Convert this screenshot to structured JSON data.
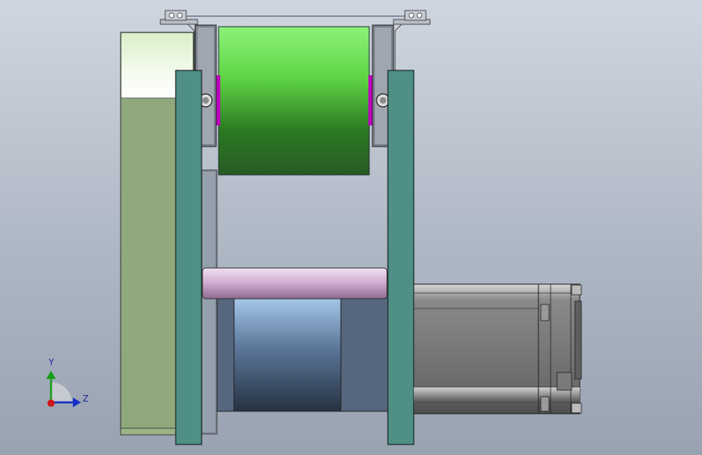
{
  "viewport": {
    "background_top": "#cfd6e0",
    "background_bottom": "#99a2b1"
  },
  "model": {
    "parts": [
      "top-roller",
      "bottom-roller",
      "shaft",
      "left-side-plate",
      "right-side-plate",
      "back-plate",
      "roller-bearing-blocks",
      "top-bracket",
      "motor"
    ],
    "colors": {
      "top_roller": "#3fbf2f",
      "bottom_roller": "#6f9cc8",
      "shaft": "#d9b6d6",
      "side_plate": "#4f8f85",
      "back_plate": "#8fa97d",
      "motor": "#6e6e6e",
      "bearing_accent": "#c000c0"
    }
  },
  "triad": {
    "y_label": "Y",
    "z_label": "Z",
    "y_color": "#18a018",
    "z_color": "#1830c8",
    "x_color": "#d01818"
  }
}
